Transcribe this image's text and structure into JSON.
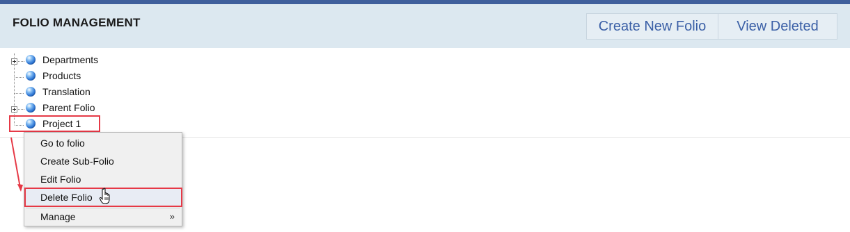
{
  "header": {
    "title": "FOLIO MANAGEMENT",
    "create_label": "Create New Folio",
    "view_deleted_label": "View Deleted"
  },
  "tree": {
    "items": [
      {
        "label": "Departments",
        "expandable": true
      },
      {
        "label": "Products",
        "expandable": false
      },
      {
        "label": "Translation",
        "expandable": false
      },
      {
        "label": "Parent Folio",
        "expandable": true
      },
      {
        "label": "Project 1",
        "expandable": false,
        "selected": true
      }
    ]
  },
  "context_menu": {
    "items": [
      {
        "label": "Go to folio"
      },
      {
        "label": "Create Sub-Folio"
      },
      {
        "label": "Edit Folio"
      },
      {
        "label": "Delete Folio",
        "highlighted": true
      },
      {
        "label": "Manage",
        "submenu_glyph": "»"
      }
    ]
  },
  "colors": {
    "accent_bar": "#3f5f9c",
    "header_bg": "#dce8f0",
    "button_text": "#3a5fa6",
    "annotation_red": "#e63946"
  },
  "icons": {
    "folio": "globe-icon",
    "expander": "plus-box-icon",
    "cursor": "hand-pointer-icon"
  }
}
